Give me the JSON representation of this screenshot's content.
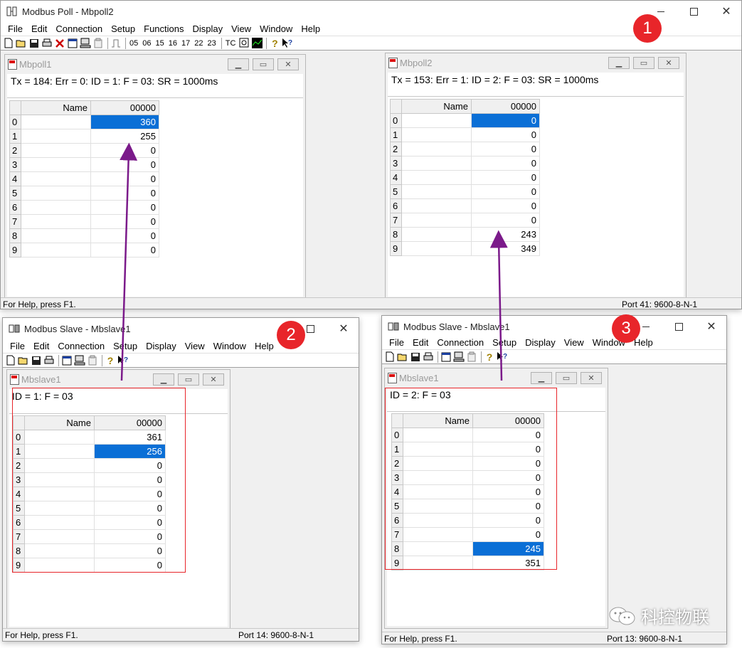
{
  "poll_app": {
    "title": "Modbus Poll - Mbpoll2",
    "menu": [
      "File",
      "Edit",
      "Connection",
      "Setup",
      "Functions",
      "Display",
      "View",
      "Window",
      "Help"
    ],
    "toolbar_codes": [
      "05",
      "06",
      "15",
      "16",
      "17",
      "22",
      "23"
    ],
    "toolbar_tc": "TC",
    "status_help": "For Help, press F1.",
    "status_port": "Port 41: 9600-8-N-1",
    "mbpoll1": {
      "title": "Mbpoll1",
      "status_line": "Tx = 184: Err = 0: ID = 1: F = 03: SR = 1000ms",
      "col_name": "Name",
      "col_addr": "00000",
      "rows": [
        {
          "idx": "0",
          "name": "",
          "value": "360"
        },
        {
          "idx": "1",
          "name": "",
          "value": "255"
        },
        {
          "idx": "2",
          "name": "",
          "value": "0"
        },
        {
          "idx": "3",
          "name": "",
          "value": "0"
        },
        {
          "idx": "4",
          "name": "",
          "value": "0"
        },
        {
          "idx": "5",
          "name": "",
          "value": "0"
        },
        {
          "idx": "6",
          "name": "",
          "value": "0"
        },
        {
          "idx": "7",
          "name": "",
          "value": "0"
        },
        {
          "idx": "8",
          "name": "",
          "value": "0"
        },
        {
          "idx": "9",
          "name": "",
          "value": "0"
        }
      ]
    },
    "mbpoll2": {
      "title": "Mbpoll2",
      "status_line": "Tx = 153: Err = 1: ID = 2: F = 03: SR = 1000ms",
      "col_name": "Name",
      "col_addr": "00000",
      "rows": [
        {
          "idx": "0",
          "name": "",
          "value": "0"
        },
        {
          "idx": "1",
          "name": "",
          "value": "0"
        },
        {
          "idx": "2",
          "name": "",
          "value": "0"
        },
        {
          "idx": "3",
          "name": "",
          "value": "0"
        },
        {
          "idx": "4",
          "name": "",
          "value": "0"
        },
        {
          "idx": "5",
          "name": "",
          "value": "0"
        },
        {
          "idx": "6",
          "name": "",
          "value": "0"
        },
        {
          "idx": "7",
          "name": "",
          "value": "0"
        },
        {
          "idx": "8",
          "name": "",
          "value": "243"
        },
        {
          "idx": "9",
          "name": "",
          "value": "349"
        }
      ]
    }
  },
  "slave1": {
    "title": "Modbus Slave - Mbslave1",
    "menu": [
      "File",
      "Edit",
      "Connection",
      "Setup",
      "Display",
      "View",
      "Window",
      "Help"
    ],
    "status_help": "For Help, press F1.",
    "status_port": "Port 14: 9600-8-N-1",
    "doc": {
      "title": "Mbslave1",
      "status_line": "ID = 1: F = 03",
      "col_name": "Name",
      "col_addr": "00000",
      "rows": [
        {
          "idx": "0",
          "name": "",
          "value": "361"
        },
        {
          "idx": "1",
          "name": "",
          "value": "256"
        },
        {
          "idx": "2",
          "name": "",
          "value": "0"
        },
        {
          "idx": "3",
          "name": "",
          "value": "0"
        },
        {
          "idx": "4",
          "name": "",
          "value": "0"
        },
        {
          "idx": "5",
          "name": "",
          "value": "0"
        },
        {
          "idx": "6",
          "name": "",
          "value": "0"
        },
        {
          "idx": "7",
          "name": "",
          "value": "0"
        },
        {
          "idx": "8",
          "name": "",
          "value": "0"
        },
        {
          "idx": "9",
          "name": "",
          "value": "0"
        }
      ]
    }
  },
  "slave2": {
    "title": "Modbus Slave - Mbslave1",
    "menu": [
      "File",
      "Edit",
      "Connection",
      "Setup",
      "Display",
      "View",
      "Window",
      "Help"
    ],
    "status_help": "For Help, press F1.",
    "status_port": "Port 13: 9600-8-N-1",
    "doc": {
      "title": "Mbslave1",
      "status_line": "ID = 2: F = 03",
      "col_name": "Name",
      "col_addr": "00000",
      "rows": [
        {
          "idx": "0",
          "name": "",
          "value": "0"
        },
        {
          "idx": "1",
          "name": "",
          "value": "0"
        },
        {
          "idx": "2",
          "name": "",
          "value": "0"
        },
        {
          "idx": "3",
          "name": "",
          "value": "0"
        },
        {
          "idx": "4",
          "name": "",
          "value": "0"
        },
        {
          "idx": "5",
          "name": "",
          "value": "0"
        },
        {
          "idx": "6",
          "name": "",
          "value": "0"
        },
        {
          "idx": "7",
          "name": "",
          "value": "0"
        },
        {
          "idx": "8",
          "name": "",
          "value": "245"
        },
        {
          "idx": "9",
          "name": "",
          "value": "351"
        }
      ]
    }
  },
  "selected_cells": {
    "mbpoll1_row": 0,
    "mbpoll2_row": 0,
    "slave1_row": 1,
    "slave2_row": 8
  },
  "badges": [
    "1",
    "2",
    "3"
  ],
  "watermark": "科控物联",
  "colors": {
    "selection": "#0a6fd6",
    "badge": "#e8252a",
    "annotation_box": "#e8252a",
    "arrow": "#7b1a8a"
  },
  "icons": {
    "toolbar": [
      "new-icon",
      "open-icon",
      "save-icon",
      "print-icon",
      "disconnect-icon",
      "window-icon",
      "connect-icon",
      "settings-icon",
      "pulse-icon",
      "scope-icon",
      "chart-icon",
      "help-icon",
      "context-help-icon"
    ]
  }
}
